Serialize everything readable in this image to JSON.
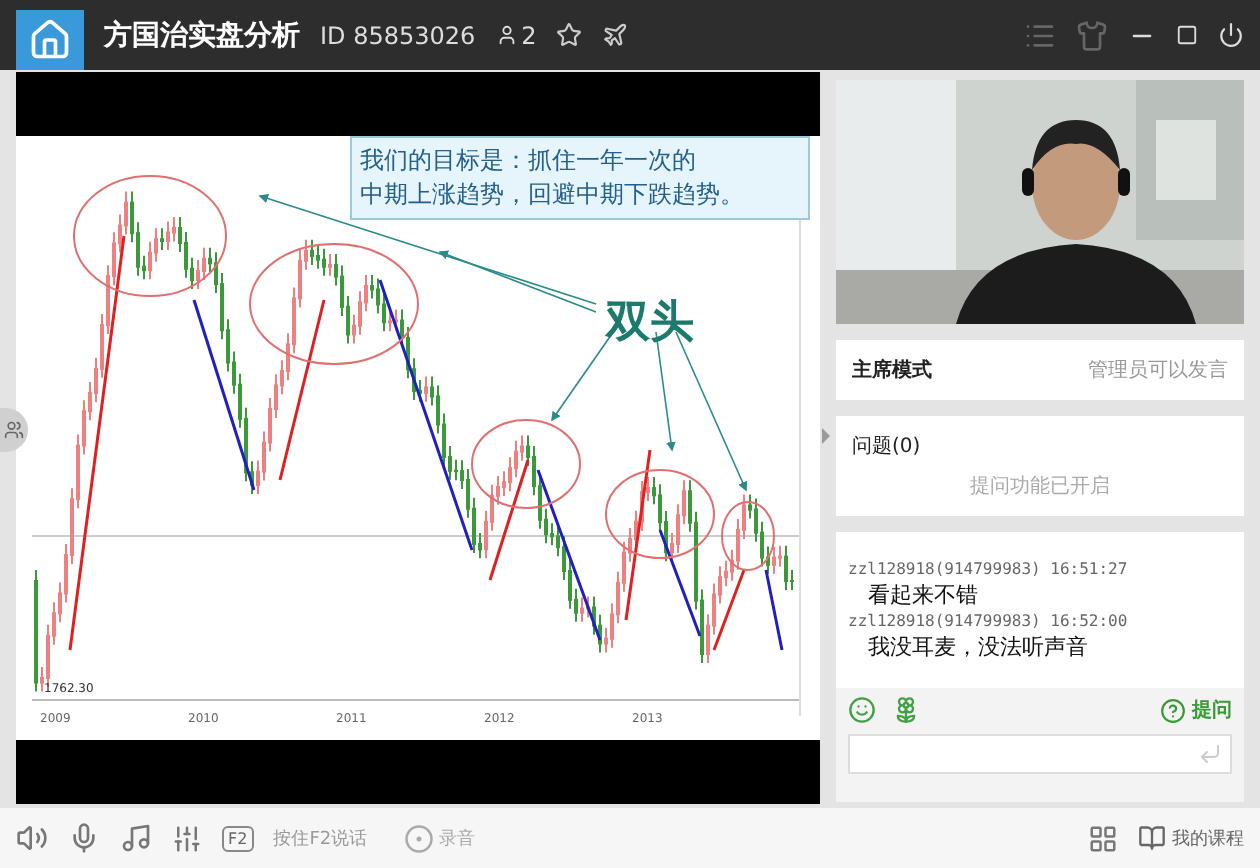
{
  "window": {
    "title": "方国治实盘分析",
    "room_id": "ID 85853026",
    "user_count": "2"
  },
  "video": {
    "callout": [
      "我们的目标是：抓住一年一次的",
      "中期上涨趋势，回避中期下跌趋势。"
    ],
    "annotation": "双头",
    "low_label": "1762.30",
    "years": [
      "2009",
      "2010",
      "2011",
      "2012",
      "2013"
    ]
  },
  "mode": {
    "label": "主席模式",
    "value": "管理员可以发言"
  },
  "questions": {
    "title": "问题(0)",
    "status": "提问功能已开启"
  },
  "messages": [
    {
      "sender": "zzl128918(914799983) 16:51:27",
      "text": "看起来不错"
    },
    {
      "sender": "zzl128918(914799983) 16:52:00",
      "text": "我没耳麦，没法听声音"
    }
  ],
  "ask_button": "提问",
  "toolbar": {
    "f2_key": "F2",
    "push_to_talk": "按住F2说话",
    "record": "录音",
    "my_courses": "我的课程"
  }
}
